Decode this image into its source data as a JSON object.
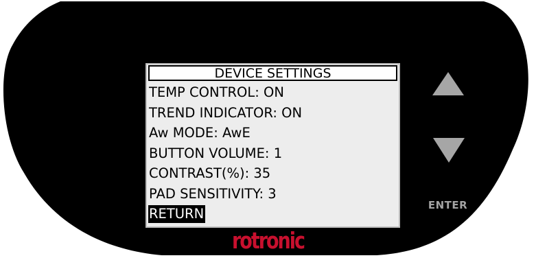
{
  "device": {
    "title": "DEVICE SETTINGS",
    "menu": [
      {
        "label": "TEMP CONTROL: ON",
        "selected": false
      },
      {
        "label": "TREND INDICATOR: ON",
        "selected": false
      },
      {
        "label": "Aw MODE: AwE",
        "selected": false
      },
      {
        "label": "BUTTON VOLUME: 1",
        "selected": false
      },
      {
        "label": "CONTRAST(%): 35",
        "selected": false
      },
      {
        "label": "PAD SENSITIVITY: 3",
        "selected": false
      },
      {
        "label": "RETURN",
        "selected": true
      }
    ],
    "enter_label": "ENTER",
    "brand": "rotronic"
  },
  "icons": {
    "up": "up-triangle-icon",
    "down": "down-triangle-icon"
  },
  "colors": {
    "bezel": "#000000",
    "screen": "#ededed",
    "key": "#a6a6a6",
    "brand": "#c8102e",
    "selection": "#000000"
  }
}
